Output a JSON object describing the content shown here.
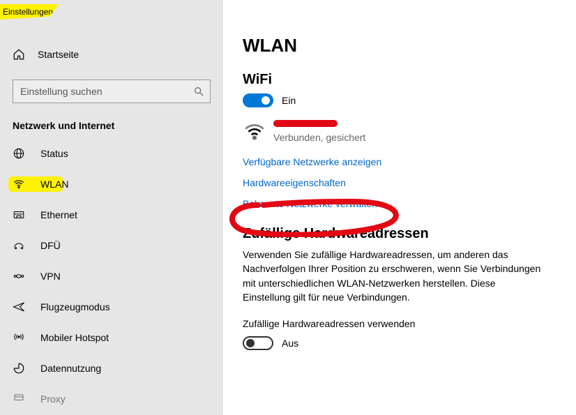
{
  "app_title": "Einstellungen",
  "sidebar": {
    "home_label": "Startseite",
    "search_placeholder": "Einstellung suchen",
    "section_label": "Netzwerk und Internet",
    "items": [
      {
        "label": "Status"
      },
      {
        "label": "WLAN"
      },
      {
        "label": "Ethernet"
      },
      {
        "label": "DFÜ"
      },
      {
        "label": "VPN"
      },
      {
        "label": "Flugzeugmodus"
      },
      {
        "label": "Mobiler Hotspot"
      },
      {
        "label": "Datennutzung"
      },
      {
        "label": "Proxy"
      }
    ]
  },
  "main": {
    "page_title": "WLAN",
    "wifi_heading": "WiFi",
    "wifi_toggle_label": "Ein",
    "connected_status": "Verbunden, gesichert",
    "link_show_available": "Verfügbare Netzwerke anzeigen",
    "link_hw_props": "Hardwareeigenschaften",
    "link_manage_known": "Bekannte Netzwerke verwalten",
    "random_heading": "Zufällige Hardwareadressen",
    "random_body": "Verwenden Sie zufällige Hardwareadressen, um anderen das Nachverfolgen Ihrer Position zu erschweren, wenn Sie Verbindungen mit unterschiedlichen WLAN-Netzwerken herstellen. Diese Einstellung gilt für neue Verbindungen.",
    "random_subheading": "Zufällige Hardwareadressen verwenden",
    "random_toggle_label": "Aus"
  }
}
